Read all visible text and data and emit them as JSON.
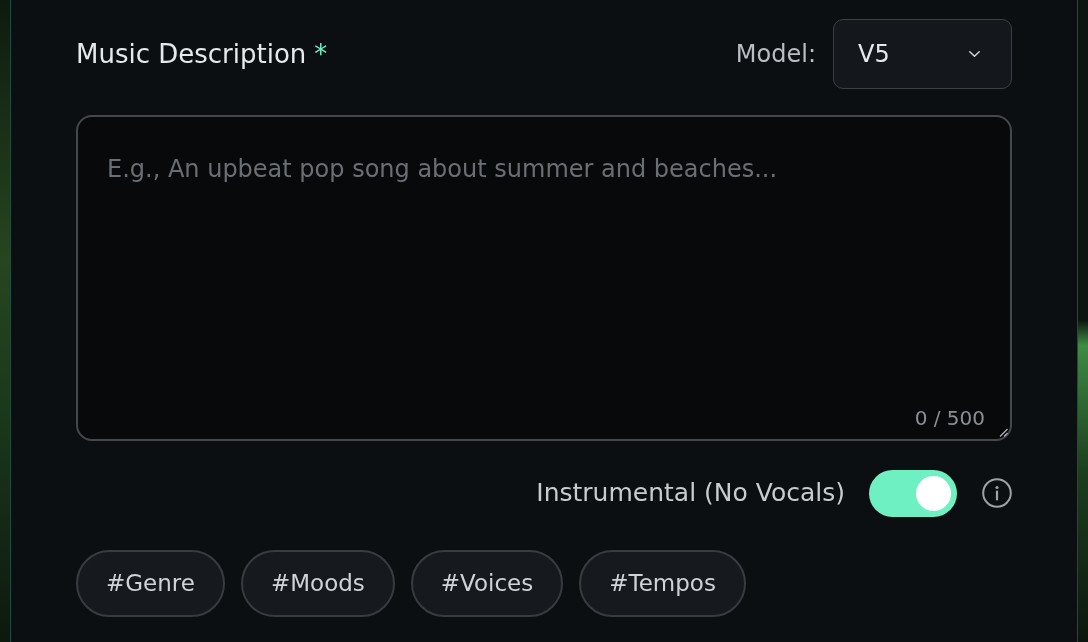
{
  "description": {
    "label": "Music Description",
    "required_mark": "*",
    "placeholder": "E.g., An upbeat pop song about summer and beaches...",
    "counter": "0 / 500"
  },
  "model": {
    "label": "Model:",
    "value": "V5"
  },
  "instrumental": {
    "label": "Instrumental (No Vocals)",
    "on": true
  },
  "tags": [
    "#Genre",
    "#Moods",
    "#Voices",
    "#Tempos"
  ]
}
